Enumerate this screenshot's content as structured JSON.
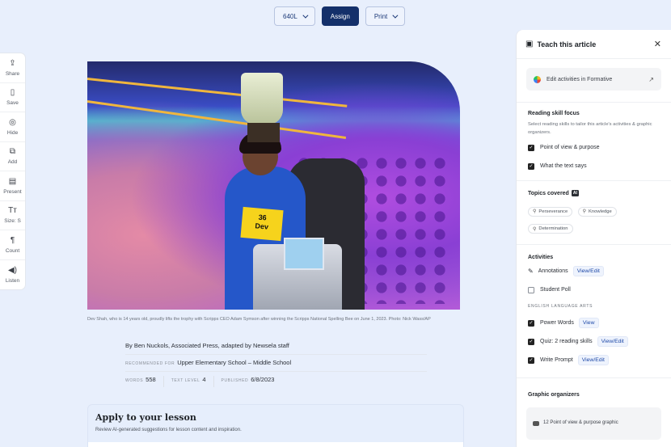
{
  "toolbar": {
    "level_label": "640L",
    "assign_label": "Assign",
    "print_label": "Print"
  },
  "rail": {
    "items": [
      {
        "icon": "share-icon",
        "glyph": "⇪",
        "label": "Share"
      },
      {
        "icon": "bookmark-icon",
        "glyph": "▯",
        "label": "Save"
      },
      {
        "icon": "eye-off-icon",
        "glyph": "◎",
        "label": "Hide"
      },
      {
        "icon": "add-copy-icon",
        "glyph": "⧉",
        "label": "Add"
      },
      {
        "icon": "present-icon",
        "glyph": "▤",
        "label": "Present"
      },
      {
        "icon": "text-size-icon",
        "glyph": "Tт",
        "label": "Size: S"
      },
      {
        "icon": "paragraph-icon",
        "glyph": "¶",
        "label": "Count"
      },
      {
        "icon": "speaker-icon",
        "glyph": "◀)",
        "label": "Listen"
      }
    ]
  },
  "article": {
    "image_bib_number": "36",
    "image_bib_name": "Dev",
    "caption": "Dev Shah, who is 14 years old, proudly lifts the trophy with Scripps CEO Adam Symson after winning the Scripps National Spelling Bee on June 1, 2023. Photo: Nick Wass/AP",
    "byline": "By Ben Nuckols, Associated Press, adapted by Newsela staff",
    "recommended_label": "Recommended for",
    "recommended_value": "Upper Elementary School – Middle School",
    "words_label": "Words",
    "words_value": "558",
    "text_level_label": "Text level",
    "text_level_value": "4",
    "published_label": "Published",
    "published_value": "6/8/2023"
  },
  "lesson": {
    "title": "Apply to your lesson",
    "description": "Review AI-generated suggestions for lesson content and inspiration."
  },
  "panel": {
    "title": "Teach this article",
    "formative_label": "Edit activities in Formative",
    "reading_skill": {
      "title": "Reading skill focus",
      "description": "Select reading skills to tailor this article's activities & graphic organizers.",
      "options": [
        {
          "label": "Point of view & purpose",
          "checked": true
        },
        {
          "label": "What the text says",
          "checked": true
        }
      ]
    },
    "topics": {
      "title": "Topics covered",
      "badge": "AI",
      "chips": [
        "Perseverance",
        "Knowledge",
        "Determination"
      ]
    },
    "activities": {
      "title": "Activities",
      "annotations_label": "Annotations",
      "annotations_link": "View/Edit",
      "student_poll_label": "Student Poll",
      "student_poll_checked": false,
      "ela_heading": "ENGLISH LANGUAGE ARTS",
      "ela_items": [
        {
          "label": "Power Words",
          "link": "View",
          "checked": true
        },
        {
          "label": "Quiz: 2 reading skills",
          "link": "View/Edit",
          "checked": true
        },
        {
          "label": "Write Prompt",
          "link": "View/Edit",
          "checked": true
        }
      ]
    },
    "graphic_organizers": {
      "title": "Graphic organizers",
      "item_label": "12 Point of view & purpose graphic"
    }
  }
}
